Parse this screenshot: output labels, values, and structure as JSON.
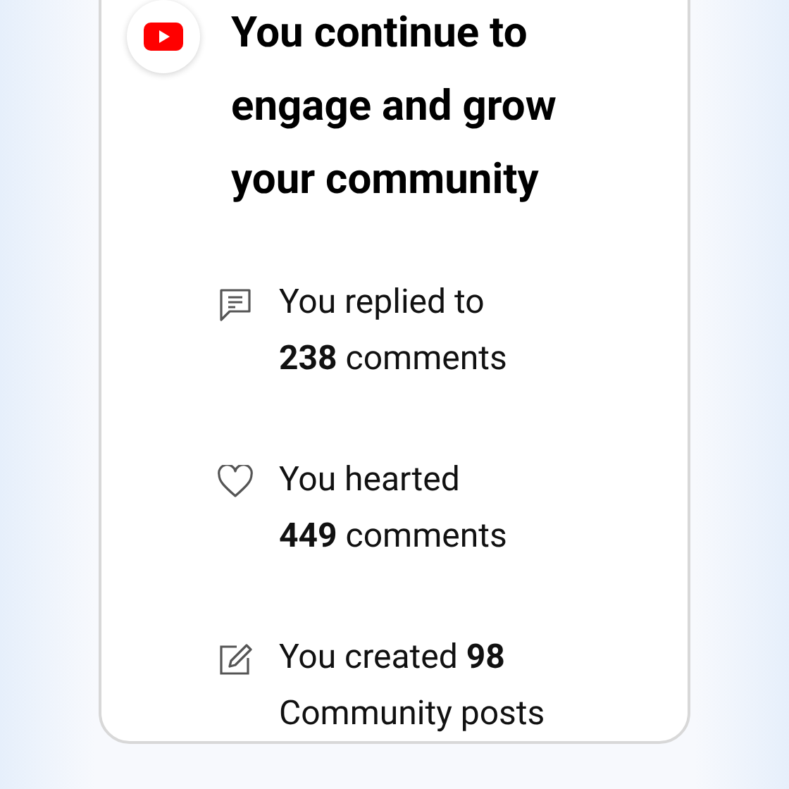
{
  "card": {
    "title": "You continue to engage and grow your community",
    "stats": [
      {
        "kind": "comment",
        "text": "You replied to\n**238** comments"
      },
      {
        "kind": "heart",
        "text": "You hearted\n**449** comments"
      },
      {
        "kind": "edit",
        "text": "You created **98**\nCommunity posts"
      }
    ]
  }
}
